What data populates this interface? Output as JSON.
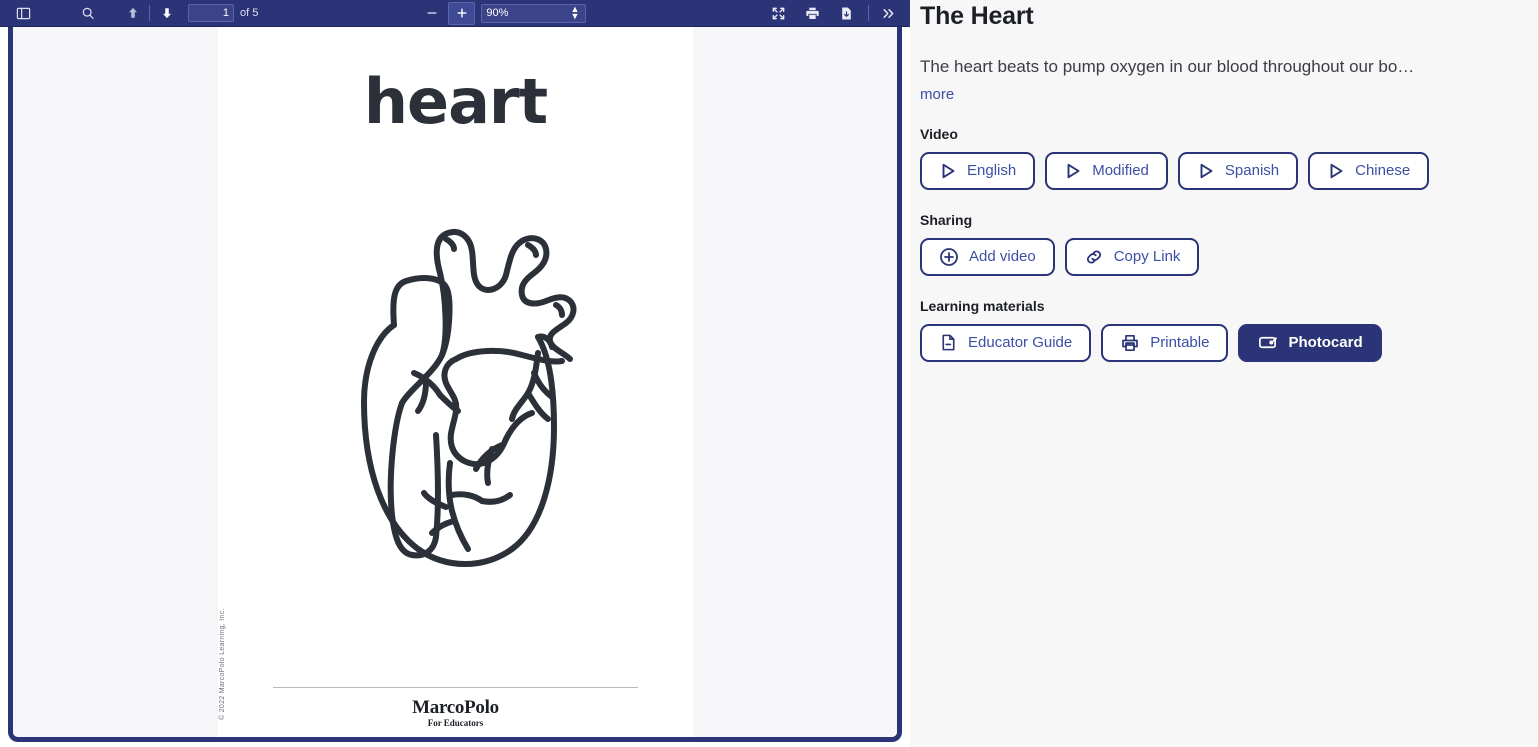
{
  "viewer": {
    "toolbar": {
      "sidebar_toggle_icon": "sidebar-toggle-icon",
      "find_icon": "search-icon",
      "previous_page_icon": "arrow-up-icon",
      "next_page_icon": "arrow-down-icon",
      "page_number_value": "1",
      "page_count_label": "of 5",
      "zoom_out_icon": "minus-icon",
      "zoom_in_icon": "plus-icon",
      "zoom_value": "90%",
      "zoom_options": [
        "90%"
      ],
      "presentation_icon": "fullscreen-icon",
      "print_icon": "print-icon",
      "download_icon": "download-icon",
      "more_tools_icon": "double-chevron-right-icon"
    },
    "page": {
      "heading": "heart",
      "illustration_name": "anatomical-heart-line-art",
      "copyright": "© 2022 MarcoPolo Learning, Inc.",
      "logo_primary": "MarcoPolo",
      "logo_secondary": "For Educators"
    }
  },
  "info": {
    "title": "The Heart",
    "description": "The heart beats to pump oxygen in our blood throughout our bo…",
    "more_label": "more",
    "video": {
      "label": "Video",
      "buttons": [
        {
          "label": "English",
          "icon": "play-icon"
        },
        {
          "label": "Modified",
          "icon": "play-icon"
        },
        {
          "label": "Spanish",
          "icon": "play-icon"
        },
        {
          "label": "Chinese",
          "icon": "play-icon"
        }
      ]
    },
    "sharing": {
      "label": "Sharing",
      "buttons": [
        {
          "label": "Add video",
          "icon": "plus-circle-icon"
        },
        {
          "label": "Copy Link",
          "icon": "link-icon"
        }
      ]
    },
    "learning": {
      "label": "Learning materials",
      "buttons": [
        {
          "label": "Educator Guide",
          "icon": "document-icon",
          "selected": false
        },
        {
          "label": "Printable",
          "icon": "printer-icon",
          "selected": false
        },
        {
          "label": "Photocard",
          "icon": "photocard-icon",
          "selected": true
        }
      ]
    }
  },
  "colors": {
    "brand_navy": "#2b3477",
    "link_blue": "#3b4fa3",
    "panel_bg": "#f7f7f7",
    "ink": "#1c1f26"
  }
}
